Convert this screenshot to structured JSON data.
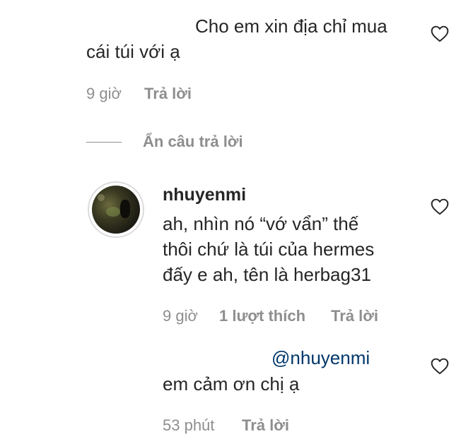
{
  "comments": [
    {
      "text_line1": "Cho em xin địa chỉ mua",
      "text_line2": "cái túi với ạ",
      "time": "9 giờ",
      "reply_label": "Trả lời"
    },
    {
      "username": "nhuyenmi",
      "text_line1": "ah, nhìn nó “vớ vẩn” thế",
      "text_line2": "thôi chứ là túi của hermes",
      "text_line3": "đấy e ah, tên là herbag31",
      "time": "9 giờ",
      "likes": "1 lượt thích",
      "reply_label": "Trả lời"
    },
    {
      "mention": "@nhuyenmi",
      "text": "em cảm ơn chị ạ",
      "time": "53 phút",
      "reply_label": "Trả lời"
    }
  ],
  "hide_replies_label": "Ẩn câu trả lời",
  "icons": {
    "like": "heart-outline-icon"
  },
  "colors": {
    "text": "#262626",
    "secondary": "#8e8e8e",
    "mention": "#00376b"
  }
}
